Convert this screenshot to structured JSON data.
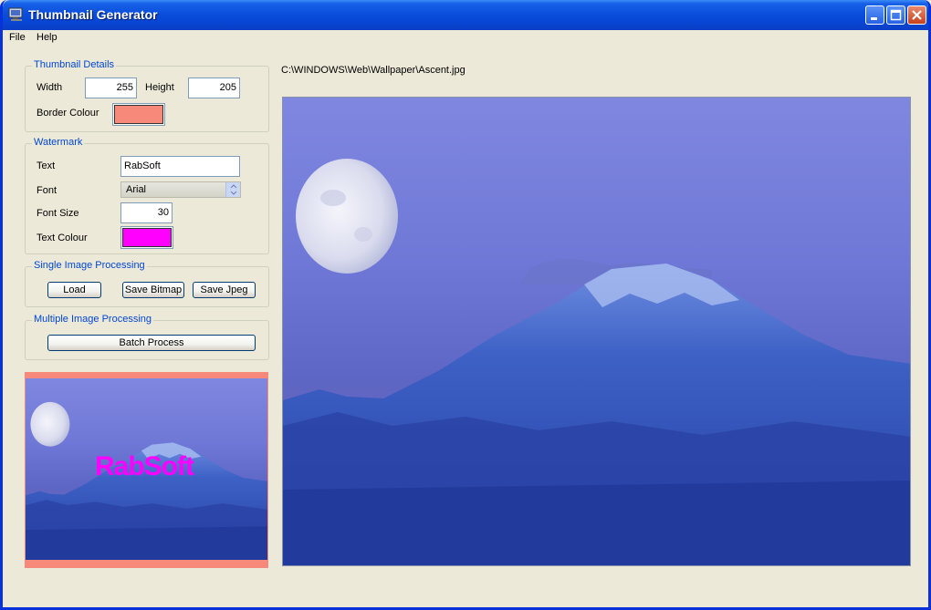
{
  "window": {
    "title": "Thumbnail Generator"
  },
  "menu": [
    "File",
    "Help"
  ],
  "thumbnail_details": {
    "legend": "Thumbnail Details",
    "width_label": "Width",
    "width_value": "255",
    "height_label": "Height",
    "height_value": "205",
    "border_colour_label": "Border Colour",
    "border_colour": "#f7897a"
  },
  "watermark": {
    "legend": "Watermark",
    "text_label": "Text",
    "text_value": "RabSoft",
    "font_label": "Font",
    "font_value": "Arial",
    "font_size_label": "Font Size",
    "font_size_value": "30",
    "text_colour_label": "Text Colour",
    "text_colour": "#ff00ff"
  },
  "single": {
    "legend": "Single Image Processing",
    "load": "Load",
    "save_bitmap": "Save Bitmap",
    "save_jpeg": "Save Jpeg"
  },
  "multiple": {
    "legend": "Multiple Image Processing",
    "batch": "Batch Process"
  },
  "image": {
    "path": "C:\\WINDOWS\\Web\\Wallpaper\\Ascent.jpg"
  },
  "thumbnail_preview": {
    "watermark_text": "RabSoft"
  },
  "colors": {
    "title_bar": "#0a4fdc",
    "group_title": "#0046d5",
    "sky": "#6d78d6",
    "mountain": "#2a4fb4"
  },
  "icons": [
    "app-icon",
    "minimize-icon",
    "maximize-icon",
    "close-icon"
  ]
}
